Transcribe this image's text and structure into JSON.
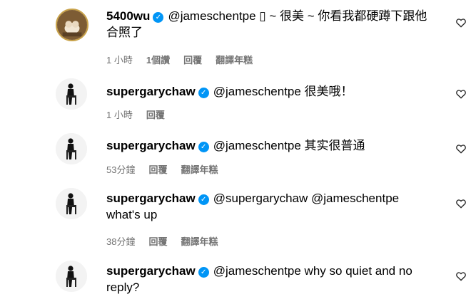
{
  "comments": [
    {
      "username": "5400wu",
      "text": "@jameschentpe ▯ ~ 很美 ~ 你看我都硬蹲下跟他合照了",
      "time": "1 小時",
      "likes": "1個讚",
      "reply": "回覆",
      "translate": "翻譯年糕"
    },
    {
      "username": "supergarychaw",
      "text": "@jameschentpe 很美哦！",
      "time": "1 小時",
      "reply": "回覆"
    },
    {
      "username": "supergarychaw",
      "text": "@jameschentpe 其实很普通",
      "time": "53分鐘",
      "reply": "回覆",
      "translate": "翻譯年糕"
    },
    {
      "username": "supergarychaw",
      "text": "@supergarychaw @jameschentpe what's up",
      "time": "38分鐘",
      "reply": "回覆",
      "translate": "翻譯年糕"
    },
    {
      "username": "supergarychaw",
      "text": "@jameschentpe why so quiet and no reply?"
    }
  ],
  "icons": {
    "verified": "verified-badge-icon",
    "like": "heart-icon"
  },
  "colors": {
    "verified": "#0095f6",
    "meta_text": "#737373"
  }
}
